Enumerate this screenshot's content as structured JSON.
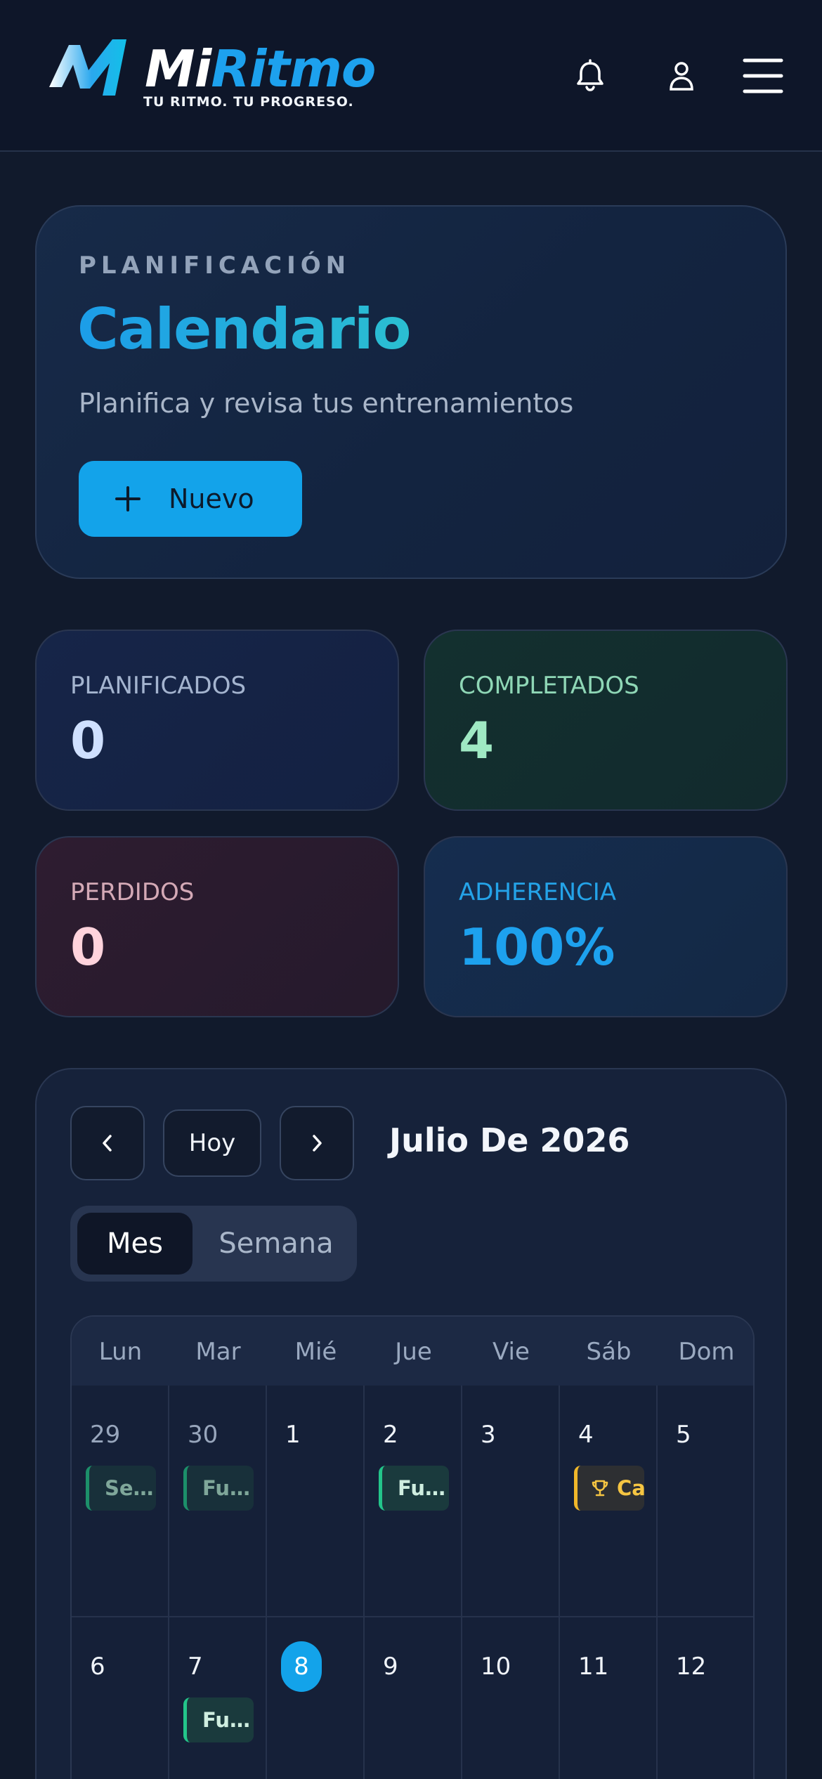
{
  "app": {
    "name_part1": "Mi",
    "name_part2": "Ritmo",
    "tagline": "TU RITMO. TU PROGRESO.",
    "accent_color": "#1da1ee"
  },
  "header": {
    "icons": [
      "bell-icon",
      "user-icon",
      "menu-icon"
    ]
  },
  "hero": {
    "eyebrow": "PLANIFICACIÓN",
    "title": "Calendario",
    "subtitle": "Planifica y revisa tus entrenamientos",
    "new_button": "Nuevo"
  },
  "stats": {
    "planned": {
      "label": "PLANIFICADOS",
      "value": "0"
    },
    "completed": {
      "label": "COMPLETADOS",
      "value": "4"
    },
    "missed": {
      "label": "PERDIDOS",
      "value": "0"
    },
    "adherence": {
      "label": "ADHERENCIA",
      "value": "100%"
    }
  },
  "calendar": {
    "today_button": "Hoy",
    "month_title": "Julio De 2026",
    "views": {
      "month": "Mes",
      "week": "Semana",
      "selected": "Mes"
    },
    "weekdays": [
      "Lun",
      "Mar",
      "Mié",
      "Jue",
      "Vie",
      "Sáb",
      "Dom"
    ],
    "week1": [
      {
        "day": "29",
        "event": "Se…"
      },
      {
        "day": "30",
        "event": "Fu…"
      },
      {
        "day": "1",
        "event": ""
      },
      {
        "day": "2",
        "event": "Fu…"
      },
      {
        "day": "3",
        "event": ""
      },
      {
        "day": "4",
        "event": "Ca"
      },
      {
        "day": "5",
        "event": ""
      }
    ],
    "week2": [
      {
        "day": "6",
        "event": ""
      },
      {
        "day": "7",
        "event": "Fu…"
      },
      {
        "day": "8",
        "event": ""
      },
      {
        "day": "9",
        "event": ""
      },
      {
        "day": "10",
        "event": ""
      },
      {
        "day": "11",
        "event": ""
      },
      {
        "day": "12",
        "event": ""
      }
    ],
    "today": "8"
  }
}
